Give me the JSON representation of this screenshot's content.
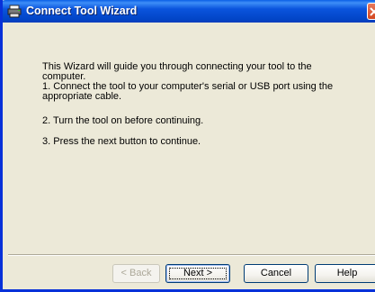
{
  "window": {
    "title": "Connect Tool Wizard",
    "icon": "printer-icon",
    "accent": "#0a54dd"
  },
  "body": {
    "intro": "This Wizard will guide you through connecting your tool to the computer.",
    "step1": "1.  Connect the tool to your computer's serial or USB port using the appropriate cable.",
    "step2": "2.  Turn the tool on before continuing.",
    "step3": "3.  Press the next button to continue."
  },
  "buttons": {
    "back": "< Back",
    "next": "Next >",
    "cancel": "Cancel",
    "help": "Help"
  }
}
